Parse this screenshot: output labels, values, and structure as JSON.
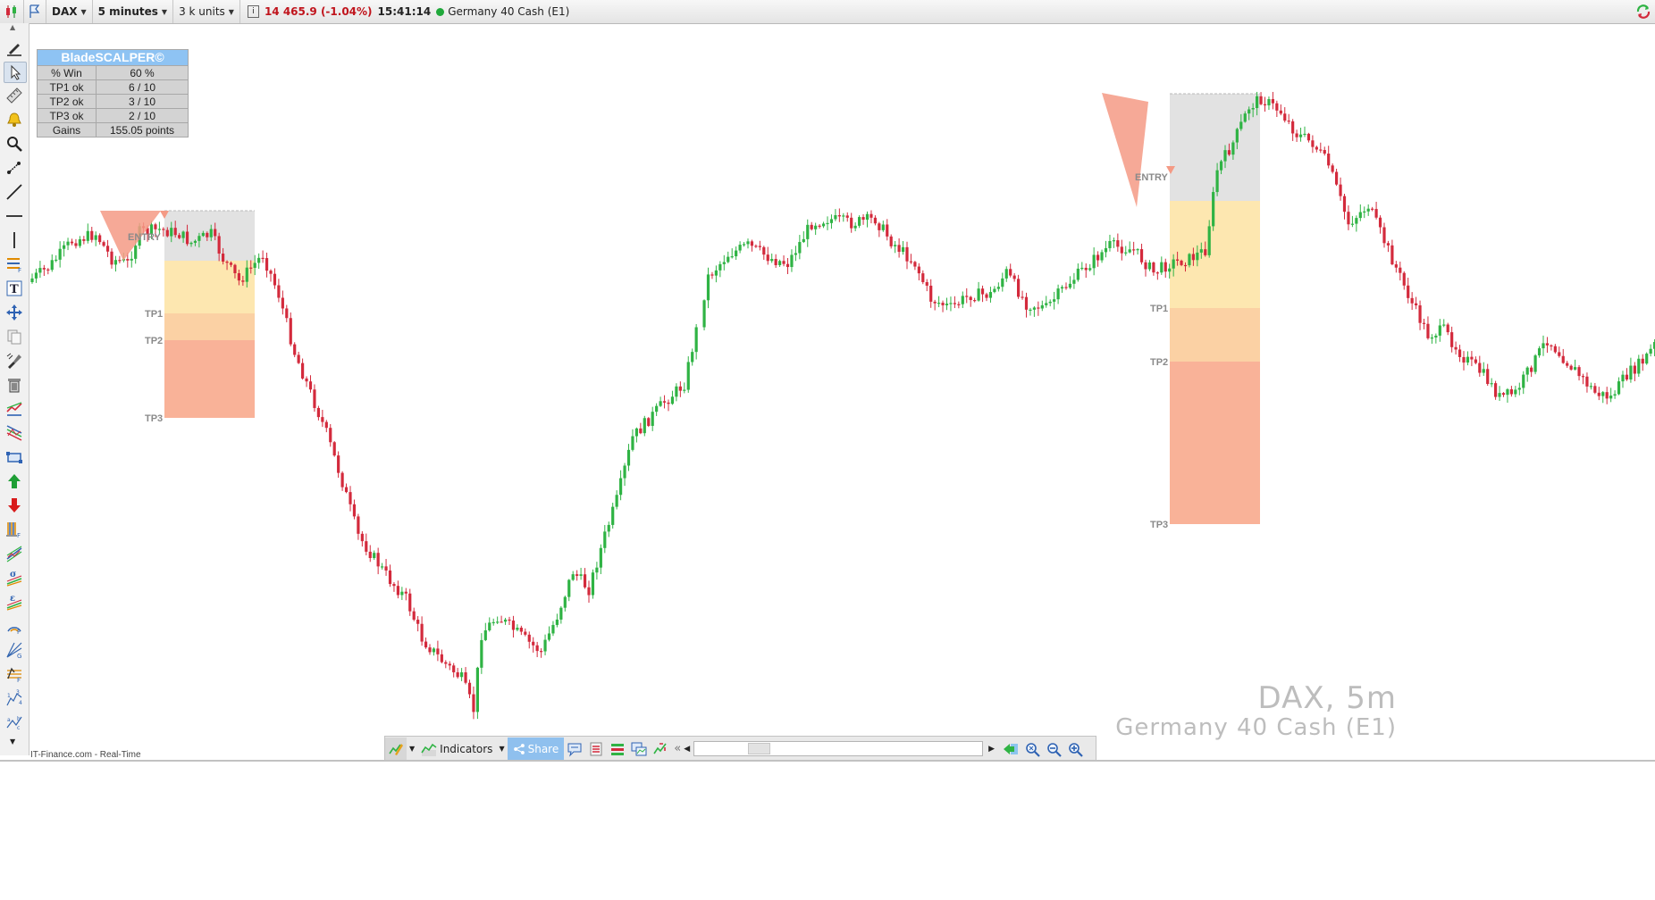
{
  "toolbar": {
    "symbol": "DAX",
    "timeframe": "5 minutes",
    "units": "3 k units",
    "info_icon": "i",
    "price_change": "14 465.9 (-1.04%)",
    "time": "15:41:14",
    "instrument": "Germany 40 Cash (E1)"
  },
  "left_tools": [
    "pencil-icon",
    "cursor-icon",
    "ruler-icon",
    "alert-bell-icon",
    "zoom-icon",
    "segment-icon",
    "trendline-icon",
    "horizontal-line-icon",
    "vertical-line-icon",
    "fibonacci-levels-icon",
    "text-icon",
    "move-icon",
    "copy-icon",
    "style-brush-icon",
    "trash-icon",
    "channel-icon",
    "regression-channel-icon",
    "rectangle-icon",
    "buy-arrow-icon",
    "sell-arrow-icon",
    "fibonacci-time-icon",
    "andrews-pitchfork-icon",
    "sigma-channel-icon",
    "epsilon-channel-icon",
    "fibonacci-arcs-icon",
    "gann-fan-icon",
    "fibonacci-fan-icon",
    "elliott-numbers-icon",
    "elliott-letters-icon"
  ],
  "stats": {
    "title": "BladeSCALPER©",
    "rows": [
      {
        "label": "% Win",
        "value": "60 %"
      },
      {
        "label": "TP1 ok",
        "value": "6  / 10"
      },
      {
        "label": "TP2 ok",
        "value": "3  / 10"
      },
      {
        "label": "TP3 ok",
        "value": "2  / 10"
      },
      {
        "label": "Gains",
        "value": "155.05  points"
      }
    ]
  },
  "trade_labels": {
    "entry": "ENTRY",
    "tp1": "TP1",
    "tp2": "TP2",
    "tp3": "TP3"
  },
  "watermark": {
    "line1": "DAX, 5m",
    "line2": "Germany 40 Cash (E1)"
  },
  "bottom": {
    "indicators_label": "Indicators",
    "share_label": "Share",
    "footer": "IT-Finance.com - Real-Time"
  },
  "colors": {
    "up_candle": "#2fb344",
    "down_candle": "#d32a3c",
    "zone_grey": "#e2e2e2",
    "zone_yellow": "#fde7b0",
    "zone_orange": "#fbd1a4",
    "zone_red": "#f9b298",
    "signal_triangle": "#f49a85",
    "stats_header": "#8ec3f3",
    "price_change": "#c0141c"
  },
  "chart_data": {
    "type": "candlestick",
    "symbol": "DAX",
    "interval": "5m",
    "close_path": [
      [
        0,
        312
      ],
      [
        4,
        300
      ],
      [
        10,
        270
      ],
      [
        16,
        262
      ],
      [
        20,
        290
      ],
      [
        24,
        295
      ],
      [
        27,
        260
      ],
      [
        32,
        257
      ],
      [
        37,
        262
      ],
      [
        40,
        272
      ],
      [
        45,
        262
      ],
      [
        48,
        290
      ],
      [
        52,
        315
      ],
      [
        56,
        295
      ],
      [
        58,
        285
      ],
      [
        62,
        330
      ],
      [
        66,
        395
      ],
      [
        70,
        440
      ],
      [
        74,
        485
      ],
      [
        78,
        540
      ],
      [
        82,
        600
      ],
      [
        86,
        625
      ],
      [
        90,
        650
      ],
      [
        94,
        670
      ],
      [
        98,
        715
      ],
      [
        103,
        740
      ],
      [
        108,
        760
      ],
      [
        111,
        795
      ],
      [
        113,
        710
      ],
      [
        117,
        690
      ],
      [
        121,
        705
      ],
      [
        125,
        720
      ],
      [
        128,
        730
      ],
      [
        132,
        690
      ],
      [
        136,
        640
      ],
      [
        140,
        660
      ],
      [
        144,
        600
      ],
      [
        147,
        560
      ],
      [
        151,
        490
      ],
      [
        155,
        470
      ],
      [
        159,
        450
      ],
      [
        164,
        430
      ],
      [
        170,
        310
      ],
      [
        175,
        285
      ],
      [
        180,
        275
      ],
      [
        186,
        290
      ],
      [
        190,
        295
      ],
      [
        196,
        250
      ],
      [
        200,
        245
      ],
      [
        206,
        250
      ],
      [
        212,
        245
      ],
      [
        216,
        270
      ],
      [
        222,
        295
      ],
      [
        226,
        335
      ],
      [
        231,
        345
      ],
      [
        236,
        330
      ],
      [
        241,
        330
      ],
      [
        245,
        305
      ],
      [
        250,
        340
      ],
      [
        255,
        345
      ],
      [
        260,
        320
      ],
      [
        266,
        295
      ],
      [
        271,
        275
      ],
      [
        277,
        280
      ],
      [
        282,
        305
      ],
      [
        286,
        295
      ],
      [
        291,
        290
      ],
      [
        295,
        280
      ],
      [
        298,
        190
      ],
      [
        302,
        160
      ],
      [
        306,
        120
      ],
      [
        309,
        110
      ],
      [
        314,
        125
      ],
      [
        318,
        150
      ],
      [
        322,
        160
      ],
      [
        326,
        185
      ],
      [
        331,
        250
      ],
      [
        336,
        230
      ],
      [
        341,
        280
      ],
      [
        347,
        340
      ],
      [
        351,
        375
      ],
      [
        355,
        370
      ],
      [
        360,
        400
      ],
      [
        365,
        420
      ],
      [
        369,
        445
      ],
      [
        373,
        440
      ],
      [
        377,
        410
      ],
      [
        381,
        380
      ],
      [
        385,
        400
      ],
      [
        389,
        420
      ],
      [
        393,
        440
      ],
      [
        397,
        445
      ],
      [
        401,
        420
      ],
      [
        405,
        405
      ],
      [
        409,
        380
      ],
      [
        413,
        360
      ],
      [
        417,
        340
      ],
      [
        421,
        330
      ],
      [
        425,
        360
      ],
      [
        429,
        375
      ],
      [
        433,
        380
      ],
      [
        437,
        390
      ]
    ],
    "trades": [
      {
        "direction": "short",
        "entry_zone": [
          236,
          292
        ],
        "tp1": 351,
        "tp2": 381,
        "tp3": 468
      },
      {
        "direction": "short",
        "entry_zone": [
          105,
          225
        ],
        "tp1": 345,
        "tp2": 405,
        "tp3": 587
      }
    ]
  }
}
